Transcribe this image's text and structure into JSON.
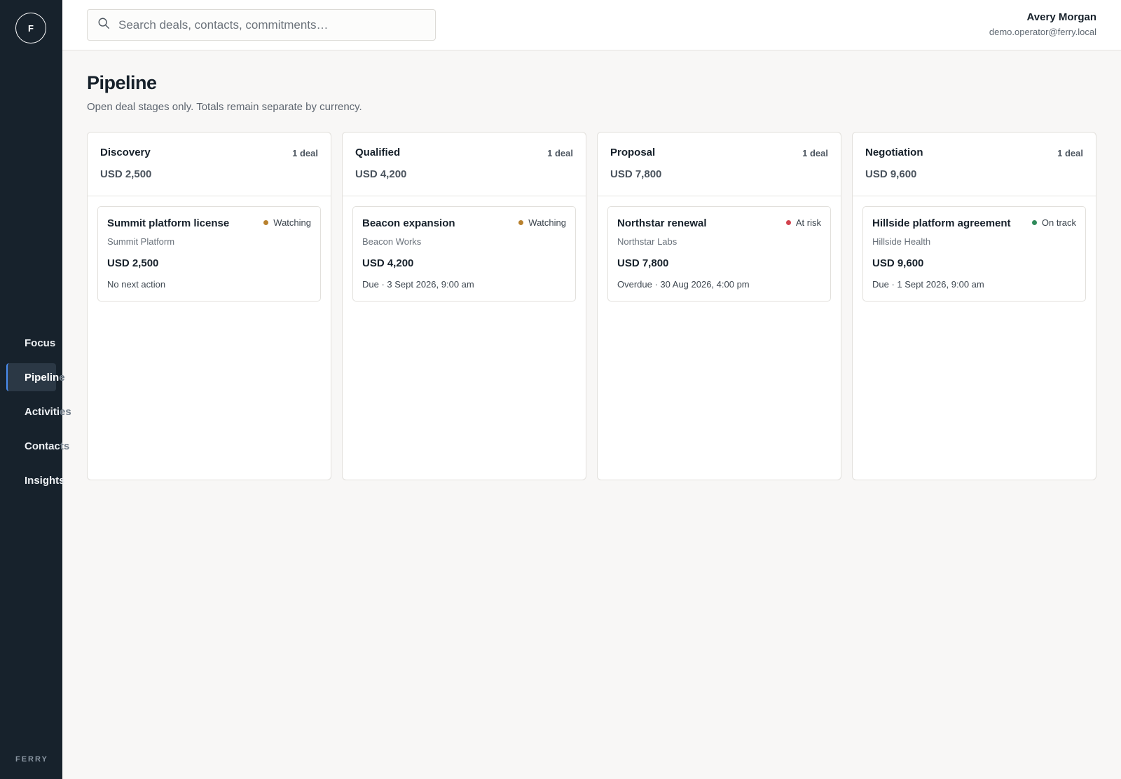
{
  "app": {
    "logo_letter": "F",
    "brand_footer": "FERRY"
  },
  "nav": [
    {
      "label_visible": "Focus",
      "label_faded": "",
      "active": false
    },
    {
      "label_visible": "Pipelin",
      "label_faded": "e",
      "active": true
    },
    {
      "label_visible": "Activiti",
      "label_faded": "es",
      "active": false
    },
    {
      "label_visible": "Contac",
      "label_faded": "ts",
      "active": false
    },
    {
      "label_visible": "Insights",
      "label_faded": "",
      "active": false
    }
  ],
  "search": {
    "placeholder": "Search deals, contacts, commitments…",
    "value": ""
  },
  "user": {
    "name": "Avery Morgan",
    "email": "demo.operator@ferry.local"
  },
  "page": {
    "title": "Pipeline",
    "subtitle": "Open deal stages only. Totals remain separate by currency."
  },
  "colors": {
    "watching": "#b8812e",
    "at_risk": "#d2434e",
    "on_track": "#2f8a5b",
    "active_accent": "#4a8df0"
  },
  "stages": [
    {
      "name": "Discovery",
      "count": "1 deal",
      "total": "USD 2,500",
      "deals": [
        {
          "title": "Summit platform license",
          "status": "Watching",
          "status_color": "#b8812e",
          "company": "Summit Platform",
          "amount": "USD 2,500",
          "next": "No next action"
        }
      ]
    },
    {
      "name": "Qualified",
      "count": "1 deal",
      "total": "USD 4,200",
      "deals": [
        {
          "title": "Beacon expansion",
          "status": "Watching",
          "status_color": "#b8812e",
          "company": "Beacon Works",
          "amount": "USD 4,200",
          "next": "Due · 3 Sept 2026, 9:00 am"
        }
      ]
    },
    {
      "name": "Proposal",
      "count": "1 deal",
      "total": "USD 7,800",
      "deals": [
        {
          "title": "Northstar renewal",
          "status": "At risk",
          "status_color": "#d2434e",
          "company": "Northstar Labs",
          "amount": "USD 7,800",
          "next": "Overdue · 30 Aug 2026, 4:00 pm"
        }
      ]
    },
    {
      "name": "Negotiation",
      "count": "1 deal",
      "total": "USD 9,600",
      "deals": [
        {
          "title": "Hillside platform agreement",
          "status": "On track",
          "status_color": "#2f8a5b",
          "company": "Hillside Health",
          "amount": "USD 9,600",
          "next": "Due · 1 Sept 2026, 9:00 am"
        }
      ]
    }
  ]
}
